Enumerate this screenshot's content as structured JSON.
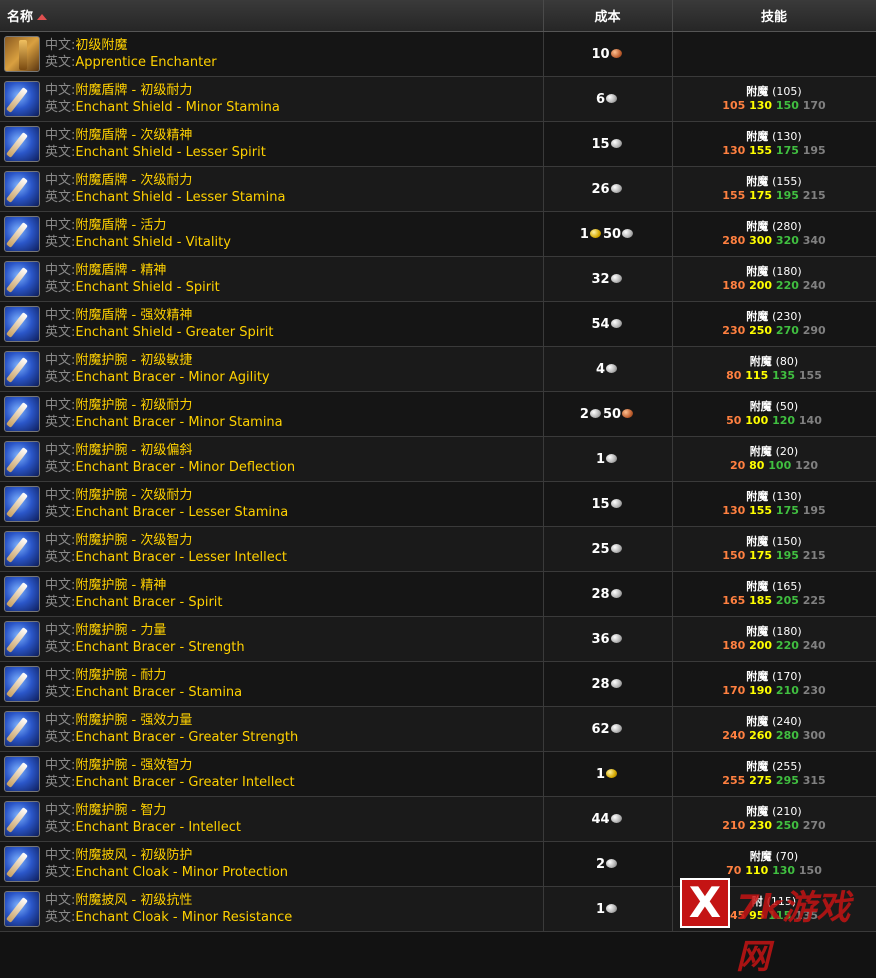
{
  "header": {
    "name": "名称",
    "cost": "成本",
    "skill": "技能"
  },
  "labels": {
    "cn": "中文:",
    "en": "英文:"
  },
  "rows": [
    {
      "icon": "book-icon",
      "cn": "初级附魔",
      "en": "Apprentice Enchanter",
      "cost": [
        {
          "amt": "10",
          "coin": "copper"
        }
      ],
      "skill": null
    },
    {
      "icon": "enchant-icon",
      "cn": "附魔盾牌 - 初级耐力",
      "en": "Enchant Shield - Minor Stamina",
      "cost": [
        {
          "amt": "6",
          "coin": "silver"
        }
      ],
      "skill": {
        "name": "附魔",
        "lvl": "(105)",
        "o": "105",
        "y": "130",
        "g": "150",
        "gr": "170"
      }
    },
    {
      "icon": "enchant-icon",
      "cn": "附魔盾牌 - 次级精神",
      "en": "Enchant Shield - Lesser Spirit",
      "cost": [
        {
          "amt": "15",
          "coin": "silver"
        }
      ],
      "skill": {
        "name": "附魔",
        "lvl": "(130)",
        "o": "130",
        "y": "155",
        "g": "175",
        "gr": "195"
      }
    },
    {
      "icon": "enchant-icon",
      "cn": "附魔盾牌 - 次级耐力",
      "en": "Enchant Shield - Lesser Stamina",
      "cost": [
        {
          "amt": "26",
          "coin": "silver"
        }
      ],
      "skill": {
        "name": "附魔",
        "lvl": "(155)",
        "o": "155",
        "y": "175",
        "g": "195",
        "gr": "215"
      }
    },
    {
      "icon": "enchant-icon",
      "cn": "附魔盾牌 - 活力",
      "en": "Enchant Shield - Vitality",
      "cost": [
        {
          "amt": "1",
          "coin": "gold"
        },
        {
          "amt": "50",
          "coin": "silver"
        }
      ],
      "skill": {
        "name": "附魔",
        "lvl": "(280)",
        "o": "280",
        "y": "300",
        "g": "320",
        "gr": "340"
      }
    },
    {
      "icon": "enchant-icon",
      "cn": "附魔盾牌 - 精神",
      "en": "Enchant Shield - Spirit",
      "cost": [
        {
          "amt": "32",
          "coin": "silver"
        }
      ],
      "skill": {
        "name": "附魔",
        "lvl": "(180)",
        "o": "180",
        "y": "200",
        "g": "220",
        "gr": "240"
      }
    },
    {
      "icon": "enchant-icon",
      "cn": "附魔盾牌 - 强效精神",
      "en": "Enchant Shield - Greater Spirit",
      "cost": [
        {
          "amt": "54",
          "coin": "silver"
        }
      ],
      "skill": {
        "name": "附魔",
        "lvl": "(230)",
        "o": "230",
        "y": "250",
        "g": "270",
        "gr": "290"
      }
    },
    {
      "icon": "enchant-icon",
      "cn": "附魔护腕 - 初级敏捷",
      "en": "Enchant Bracer - Minor Agility",
      "cost": [
        {
          "amt": "4",
          "coin": "silver"
        }
      ],
      "skill": {
        "name": "附魔",
        "lvl": "(80)",
        "o": "80",
        "y": "115",
        "g": "135",
        "gr": "155"
      }
    },
    {
      "icon": "enchant-icon",
      "cn": "附魔护腕 - 初级耐力",
      "en": "Enchant Bracer - Minor Stamina",
      "cost": [
        {
          "amt": "2",
          "coin": "silver"
        },
        {
          "amt": "50",
          "coin": "copper"
        }
      ],
      "skill": {
        "name": "附魔",
        "lvl": "(50)",
        "o": "50",
        "y": "100",
        "g": "120",
        "gr": "140"
      }
    },
    {
      "icon": "enchant-icon",
      "cn": "附魔护腕 - 初级偏斜",
      "en": "Enchant Bracer - Minor Deflection",
      "cost": [
        {
          "amt": "1",
          "coin": "silver"
        }
      ],
      "skill": {
        "name": "附魔",
        "lvl": "(20)",
        "o": "20",
        "y": "80",
        "g": "100",
        "gr": "120"
      }
    },
    {
      "icon": "enchant-icon",
      "cn": "附魔护腕 - 次级耐力",
      "en": "Enchant Bracer - Lesser Stamina",
      "cost": [
        {
          "amt": "15",
          "coin": "silver"
        }
      ],
      "skill": {
        "name": "附魔",
        "lvl": "(130)",
        "o": "130",
        "y": "155",
        "g": "175",
        "gr": "195"
      }
    },
    {
      "icon": "enchant-icon",
      "cn": "附魔护腕 - 次级智力",
      "en": "Enchant Bracer - Lesser Intellect",
      "cost": [
        {
          "amt": "25",
          "coin": "silver"
        }
      ],
      "skill": {
        "name": "附魔",
        "lvl": "(150)",
        "o": "150",
        "y": "175",
        "g": "195",
        "gr": "215"
      }
    },
    {
      "icon": "enchant-icon",
      "cn": "附魔护腕 - 精神",
      "en": "Enchant Bracer - Spirit",
      "cost": [
        {
          "amt": "28",
          "coin": "silver"
        }
      ],
      "skill": {
        "name": "附魔",
        "lvl": "(165)",
        "o": "165",
        "y": "185",
        "g": "205",
        "gr": "225"
      }
    },
    {
      "icon": "enchant-icon",
      "cn": "附魔护腕 - 力量",
      "en": "Enchant Bracer - Strength",
      "cost": [
        {
          "amt": "36",
          "coin": "silver"
        }
      ],
      "skill": {
        "name": "附魔",
        "lvl": "(180)",
        "o": "180",
        "y": "200",
        "g": "220",
        "gr": "240"
      }
    },
    {
      "icon": "enchant-icon",
      "cn": "附魔护腕 - 耐力",
      "en": "Enchant Bracer - Stamina",
      "cost": [
        {
          "amt": "28",
          "coin": "silver"
        }
      ],
      "skill": {
        "name": "附魔",
        "lvl": "(170)",
        "o": "170",
        "y": "190",
        "g": "210",
        "gr": "230"
      }
    },
    {
      "icon": "enchant-icon",
      "cn": "附魔护腕 - 强效力量",
      "en": "Enchant Bracer - Greater Strength",
      "cost": [
        {
          "amt": "62",
          "coin": "silver"
        }
      ],
      "skill": {
        "name": "附魔",
        "lvl": "(240)",
        "o": "240",
        "y": "260",
        "g": "280",
        "gr": "300"
      }
    },
    {
      "icon": "enchant-icon",
      "cn": "附魔护腕 - 强效智力",
      "en": "Enchant Bracer - Greater Intellect",
      "cost": [
        {
          "amt": "1",
          "coin": "gold"
        }
      ],
      "skill": {
        "name": "附魔",
        "lvl": "(255)",
        "o": "255",
        "y": "275",
        "g": "295",
        "gr": "315"
      }
    },
    {
      "icon": "enchant-icon",
      "cn": "附魔护腕 - 智力",
      "en": "Enchant Bracer - Intellect",
      "cost": [
        {
          "amt": "44",
          "coin": "silver"
        }
      ],
      "skill": {
        "name": "附魔",
        "lvl": "(210)",
        "o": "210",
        "y": "230",
        "g": "250",
        "gr": "270"
      }
    },
    {
      "icon": "enchant-icon",
      "cn": "附魔披风 - 初级防护",
      "en": "Enchant Cloak - Minor Protection",
      "cost": [
        {
          "amt": "2",
          "coin": "silver"
        }
      ],
      "skill": {
        "name": "附魔",
        "lvl": "(70)",
        "o": "70",
        "y": "110",
        "g": "130",
        "gr": "150"
      }
    },
    {
      "icon": "enchant-icon",
      "cn": "附魔披风 - 初级抗性",
      "en": "Enchant Cloak - Minor Resistance",
      "cost": [
        {
          "amt": "1",
          "coin": "silver"
        }
      ],
      "skill": {
        "name": "附",
        "lvl": "(115)",
        "o": "45",
        "y": "95",
        "g": "115",
        "gr": "135"
      }
    }
  ],
  "watermark": {
    "mark": "X",
    "text": "7k游戏网"
  }
}
